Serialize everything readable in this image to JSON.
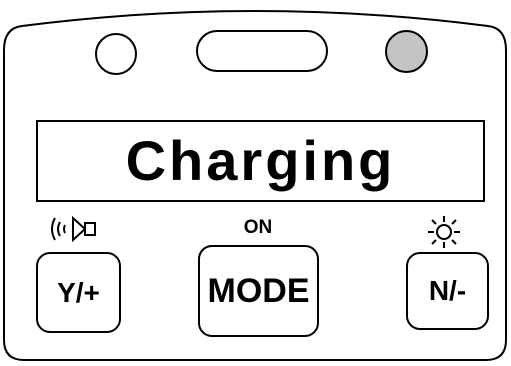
{
  "display": {
    "text": "Charging"
  },
  "buttons": {
    "y_plus": "Y/+",
    "mode": "MODE",
    "n_minus": "N/-"
  },
  "labels": {
    "on": "ON"
  },
  "icons": {
    "sound": "sound-icon",
    "brightness": "brightness-icon"
  },
  "colors": {
    "outline": "#000000",
    "background": "#ffffff",
    "led_right": "#c4c4c4",
    "led_left": "#ffffff"
  }
}
